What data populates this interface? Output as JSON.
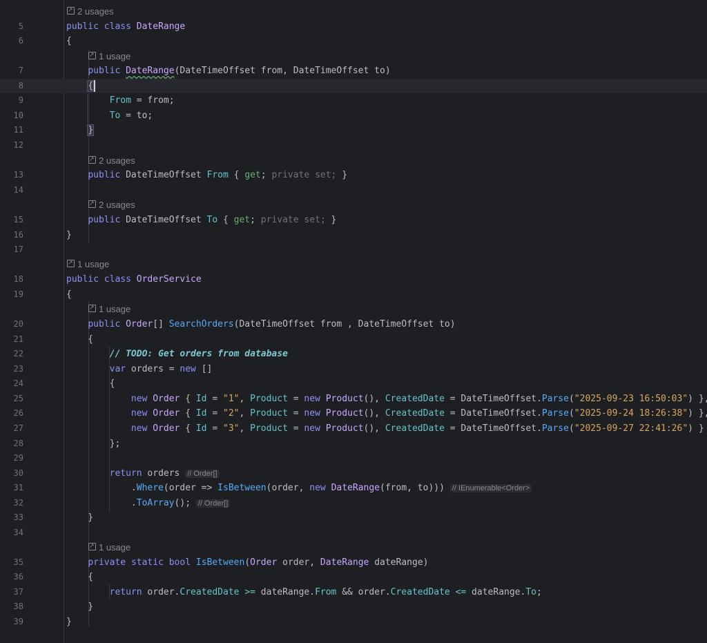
{
  "hints": {
    "h0": "2 usages",
    "h1": "1 usage",
    "h2": "2 usages",
    "h3": "2 usages",
    "h4": "1 usage",
    "h5": "1 usage",
    "h6": "1 usage"
  },
  "line_numbers": [
    "5",
    "6",
    "7",
    "8",
    "9",
    "10",
    "11",
    "12",
    "13",
    "14",
    "15",
    "16",
    "17",
    "18",
    "19",
    "20",
    "21",
    "22",
    "23",
    "24",
    "25",
    "26",
    "27",
    "28",
    "29",
    "30",
    "31",
    "32",
    "33",
    "34",
    "35",
    "36",
    "37",
    "38",
    "39"
  ],
  "inlays": {
    "orders_type": "// Order[]",
    "where_type": "// IEnumerable<Order>",
    "toarray_type": "// Order[]"
  },
  "comment": "// TODO: Get orders from database",
  "strings": {
    "id1": "\"1\"",
    "id2": "\"2\"",
    "id3": "\"3\"",
    "d1": "\"2025-09-23 16:50:03\"",
    "d2": "\"2025-09-24 18:26:38\"",
    "d3": "\"2025-09-27 22:41:26\""
  }
}
